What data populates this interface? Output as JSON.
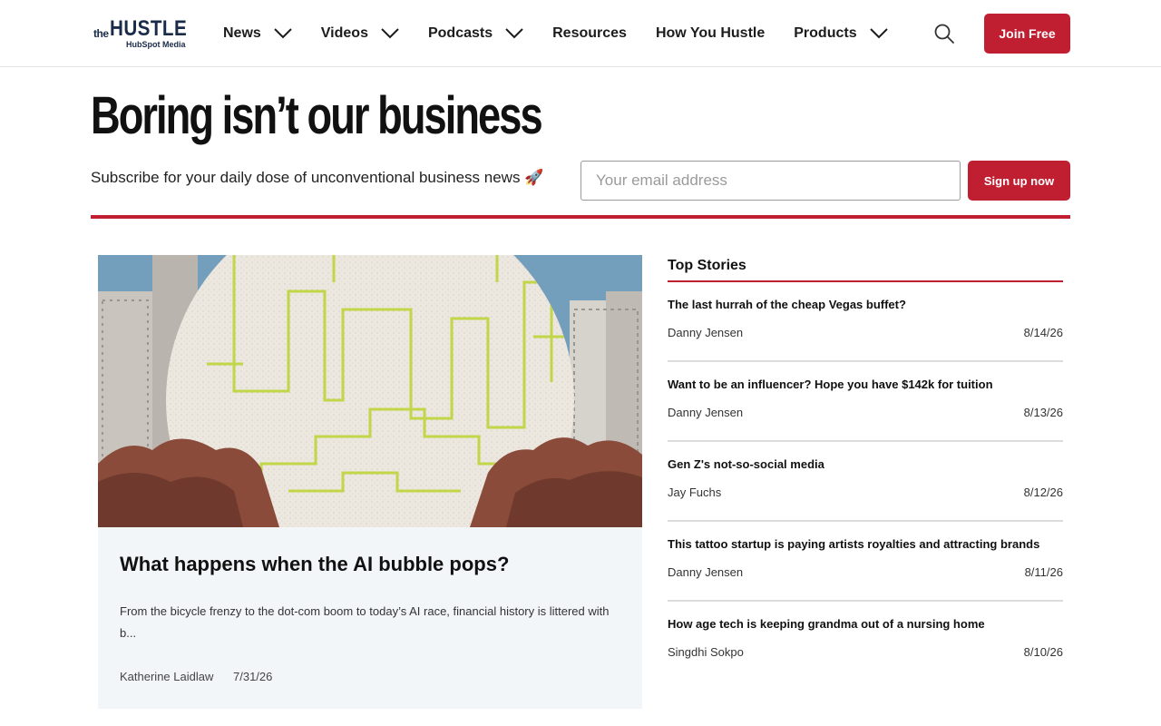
{
  "header": {
    "logo": {
      "the": "the",
      "brand": "HUSTLE",
      "sub": "HubSpot Media"
    },
    "nav": [
      {
        "label": "News",
        "dropdown": true
      },
      {
        "label": "Videos",
        "dropdown": true
      },
      {
        "label": "Podcasts",
        "dropdown": true
      },
      {
        "label": "Resources",
        "dropdown": false
      },
      {
        "label": "How You Hustle",
        "dropdown": false
      },
      {
        "label": "Products",
        "dropdown": true
      }
    ],
    "search_icon": "search-icon",
    "join_label": "Join Free"
  },
  "hero": {
    "headline": "Boring isn’t our business",
    "tagline": "Subscribe for your daily dose of unconventional business news 🚀",
    "email_placeholder": "Your email address",
    "signup_label": "Sign up now"
  },
  "feature": {
    "title": "What happens when the AI bubble pops?",
    "excerpt": "From the bicycle frenzy to the dot-com boom to today’s AI race, financial history is littered with b...",
    "author": "Katherine Laidlaw",
    "date": "7/31/26"
  },
  "top_stories": {
    "heading": "Top Stories",
    "items": [
      {
        "title": "The last hurrah of the cheap Vegas buffet?",
        "author": "Danny Jensen",
        "date": "8/14/26"
      },
      {
        "title": "Want to be an influencer? Hope you have $142k for tuition",
        "author": "Danny Jensen",
        "date": "8/13/26"
      },
      {
        "title": "Gen Z's not-so-social media",
        "author": "Jay Fuchs",
        "date": "8/12/26"
      },
      {
        "title": "This tattoo startup is paying artists royalties and attracting brands",
        "author": "Danny Jensen",
        "date": "8/11/26"
      },
      {
        "title": "How age tech is keeping grandma out of a nursing home",
        "author": "Singdhi Sokpo",
        "date": "8/10/26"
      }
    ]
  },
  "colors": {
    "accent": "#c01f32",
    "brand_navy": "#1a2b4a",
    "card_bg": "#f3f6f9"
  }
}
